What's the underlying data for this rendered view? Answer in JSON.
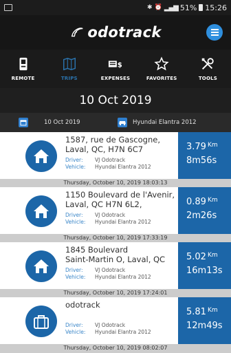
{
  "status_bar": {
    "battery": "51%",
    "time": "15:26"
  },
  "header": {
    "logo_text": "odotrack"
  },
  "tabs": [
    {
      "label": "REMOTE",
      "icon": "remote-icon",
      "active": false
    },
    {
      "label": "TRIPS",
      "icon": "map-icon",
      "active": true
    },
    {
      "label": "EXPENSES",
      "icon": "expenses-icon",
      "active": false
    },
    {
      "label": "FAVORITES",
      "icon": "star-icon",
      "active": false
    },
    {
      "label": "TOOLS",
      "icon": "tools-icon",
      "active": false
    }
  ],
  "date_title": "10 Oct 2019",
  "filters": {
    "date": "10 Oct 2019",
    "vehicle": "Hyundai Elantra 2012"
  },
  "labels": {
    "driver": "Driver:",
    "vehicle": "Vehicle:"
  },
  "trips": [
    {
      "address_line1": "1587, rue de Gascogne,",
      "address_line2": "Laval, QC, H7N 6C7",
      "driver": "VJ Odotrack",
      "vehicle": "Hyundai Elantra 2012",
      "distance": "3.79",
      "unit": "Km",
      "duration": "8m56s",
      "timestamp": "Thursday, October 10, 2019 18:03:13",
      "icon": "home-icon"
    },
    {
      "address_line1": "1150 Boulevard de l'Avenir,",
      "address_line2": "Laval, QC H7N 6L2,",
      "driver": "VJ Odotrack",
      "vehicle": "Hyundai Elantra 2012",
      "distance": "0.89",
      "unit": "Km",
      "duration": "2m26s",
      "timestamp": "Thursday, October 10, 2019 17:33:19",
      "icon": "home-icon"
    },
    {
      "address_line1": "1845 Boulevard",
      "address_line2": "Saint-Martin O, Laval, QC",
      "driver": "VJ Odotrack",
      "vehicle": "Hyundai Elantra 2012",
      "distance": "5.02",
      "unit": "Km",
      "duration": "16m13s",
      "timestamp": "Thursday, October 10, 2019 17:24:01",
      "icon": "home-icon"
    },
    {
      "address_line1": "odotrack",
      "address_line2": "",
      "driver": "VJ Odotrack",
      "vehicle": "Hyundai Elantra 2012",
      "distance": "5.81",
      "unit": "Km",
      "duration": "12m49s",
      "timestamp": "Thursday, October 10, 2019 08:02:07",
      "icon": "briefcase-icon"
    }
  ],
  "colors": {
    "accent": "#1c66a8",
    "menu": "#2f8fde",
    "header": "#161616",
    "timestamp_bar": "#cccccc"
  }
}
